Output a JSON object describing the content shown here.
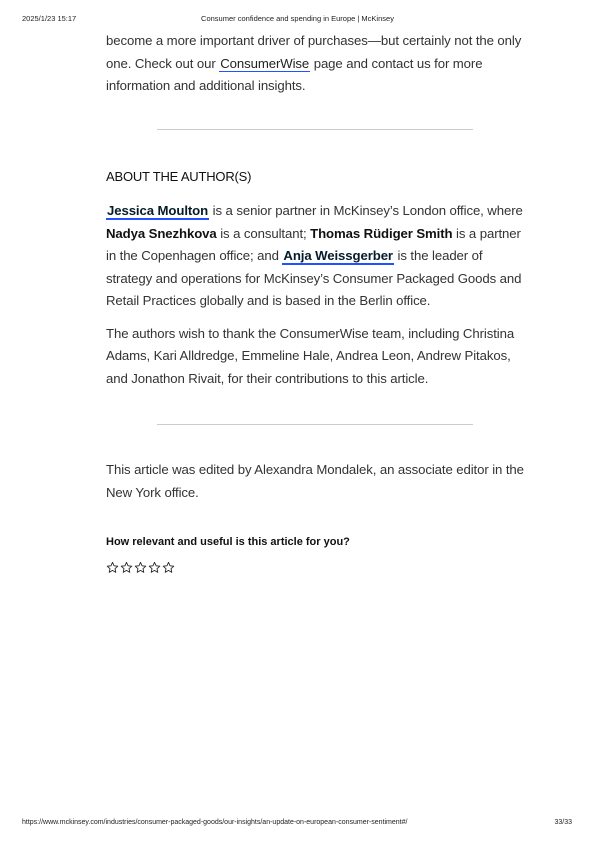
{
  "header": {
    "datetime": "2025/1/23 15:17",
    "title": "Consumer confidence and spending in Europe | McKinsey"
  },
  "intro": {
    "text_before": "become a more important driver of purchases—but certainly not the only one. Check out our ",
    "link_label": "ConsumerWise",
    "text_after": " page and contact us for more information and additional insights."
  },
  "about": {
    "heading": "ABOUT THE AUTHOR(S)",
    "author1": "Jessica Moulton",
    "text1": " is a senior partner in McKinsey’s London office, where ",
    "author2": "Nadya Snezhkova",
    "text2": " is a consultant; ",
    "author3": "Thomas Rüdiger Smith",
    "text3": " is a partner in the Copenhagen office; and ",
    "author4": "Anja Weissgerber",
    "text4": " is the leader of strategy and operations for McKinsey’s Consumer Packaged Goods and Retail Practices globally and is based in the Berlin office.",
    "thanks": "The authors wish to thank the ConsumerWise team, including Christina Adams, Kari Alldredge, Emmeline Hale, Andrea Leon, Andrew Pitakos, and Jonathon Rivait, for their contributions to this article."
  },
  "editor_note": "This article was edited by Alexandra Mondalek, an associate editor in the New York office.",
  "rating": {
    "question": "How relevant and useful is this article for you?",
    "max_stars": 5,
    "selected": 0
  },
  "footer": {
    "url": "https://www.mckinsey.com/industries/consumer-packaged-goods/our-insights/an-update-on-european-consumer-sentiment#/",
    "page": "33/33"
  }
}
